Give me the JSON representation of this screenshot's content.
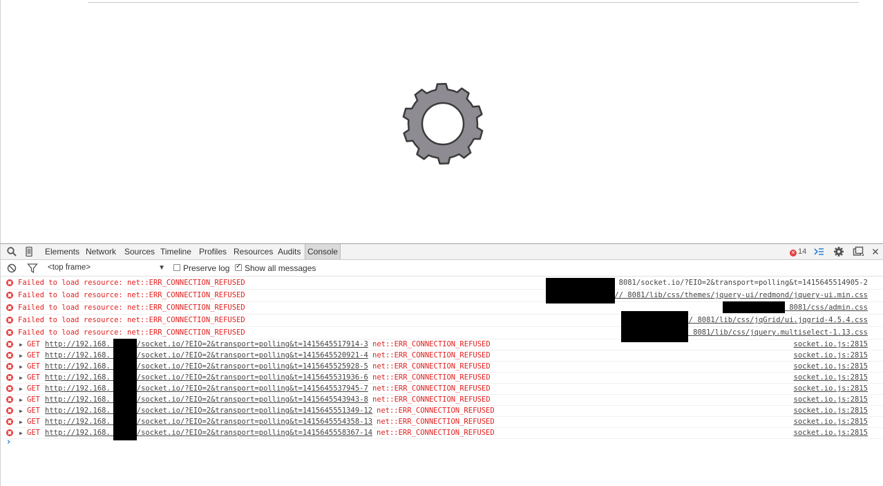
{
  "devtools": {
    "tabs": [
      "Elements",
      "Network",
      "Sources",
      "Timeline",
      "Profiles",
      "Resources",
      "Audits",
      "Console"
    ],
    "active_tab": "Console",
    "error_count": "14",
    "frame_select": "<top frame>",
    "preserve_log_label": "Preserve log",
    "show_all_label": "Show all messages",
    "show_all_checked": true,
    "preserve_log_checked": false
  },
  "console": {
    "resource_errors": [
      {
        "message": "Failed to load resource: net::ERR_CONNECTION_REFUSED",
        "url": "http://           8081/socket.io/?EIO=2&transport=polling&t=1415645514905-2",
        "underline": false
      },
      {
        "message": "Failed to load resource: net::ERR_CONNECTION_REFUSED",
        "url": "http://           8081/lib/css/themes/jquery-ui/redmond/jquery-ui.min.css",
        "underline": true
      },
      {
        "message": "Failed to load resource: net::ERR_CONNECTION_REFUSED",
        "url": "http://           8081/css/admin.css",
        "underline": true
      },
      {
        "message": "Failed to load resource: net::ERR_CONNECTION_REFUSED",
        "url": "http://           8081/lib/css/jqGrid/ui.jqgrid-4.5.4.css",
        "underline": true
      },
      {
        "message": "Failed to load resource: net::ERR_CONNECTION_REFUSED",
        "url": "http://           8081/lib/css/jquery.multiselect-1.13.css",
        "underline": true
      }
    ],
    "get_errors": [
      {
        "verb": "GET",
        "url": "http://192.168.    :8081/socket.io/?EIO=2&transport=polling&t=1415645517914-3",
        "error": "net::ERR_CONNECTION_REFUSED",
        "source": "socket.io.js:2815"
      },
      {
        "verb": "GET",
        "url": "http://192.168.    :8081/socket.io/?EIO=2&transport=polling&t=1415645520921-4",
        "error": "net::ERR_CONNECTION_REFUSED",
        "source": "socket.io.js:2815"
      },
      {
        "verb": "GET",
        "url": "http://192.168.    :8081/socket.io/?EIO=2&transport=polling&t=1415645525928-5",
        "error": "net::ERR_CONNECTION_REFUSED",
        "source": "socket.io.js:2815"
      },
      {
        "verb": "GET",
        "url": "http://192.168.    :8081/socket.io/?EIO=2&transport=polling&t=1415645531936-6",
        "error": "net::ERR_CONNECTION_REFUSED",
        "source": "socket.io.js:2815"
      },
      {
        "verb": "GET",
        "url": "http://192.168.    :8081/socket.io/?EIO=2&transport=polling&t=1415645537945-7",
        "error": "net::ERR_CONNECTION_REFUSED",
        "source": "socket.io.js:2815"
      },
      {
        "verb": "GET",
        "url": "http://192.168.    :8081/socket.io/?EIO=2&transport=polling&t=1415645543943-8",
        "error": "net::ERR_CONNECTION_REFUSED",
        "source": "socket.io.js:2815"
      },
      {
        "verb": "GET",
        "url": "http://192.168.    :8081/socket.io/?EIO=2&transport=polling&t=1415645551349-12",
        "error": "net::ERR_CONNECTION_REFUSED",
        "source": "socket.io.js:2815"
      },
      {
        "verb": "GET",
        "url": "http://192.168.    :8081/socket.io/?EIO=2&transport=polling&t=1415645554358-13",
        "error": "net::ERR_CONNECTION_REFUSED",
        "source": "socket.io.js:2815"
      },
      {
        "verb": "GET",
        "url": "http://192.168.    :8081/socket.io/?EIO=2&transport=polling&t=1415645558367-14",
        "error": "net::ERR_CONNECTION_REFUSED",
        "source": "socket.io.js:2815"
      }
    ],
    "prompt": "›"
  },
  "colors": {
    "error_red": "#e0201f",
    "gear_fill": "#8e8b92",
    "prompt_blue": "#2a7fd8"
  },
  "icons": [
    "search-icon",
    "device-icon",
    "error-count-icon",
    "drawer-icon",
    "gear-icon",
    "dock-icon",
    "close-icon",
    "clear-icon",
    "filter-icon",
    "loading-gear-icon"
  ]
}
